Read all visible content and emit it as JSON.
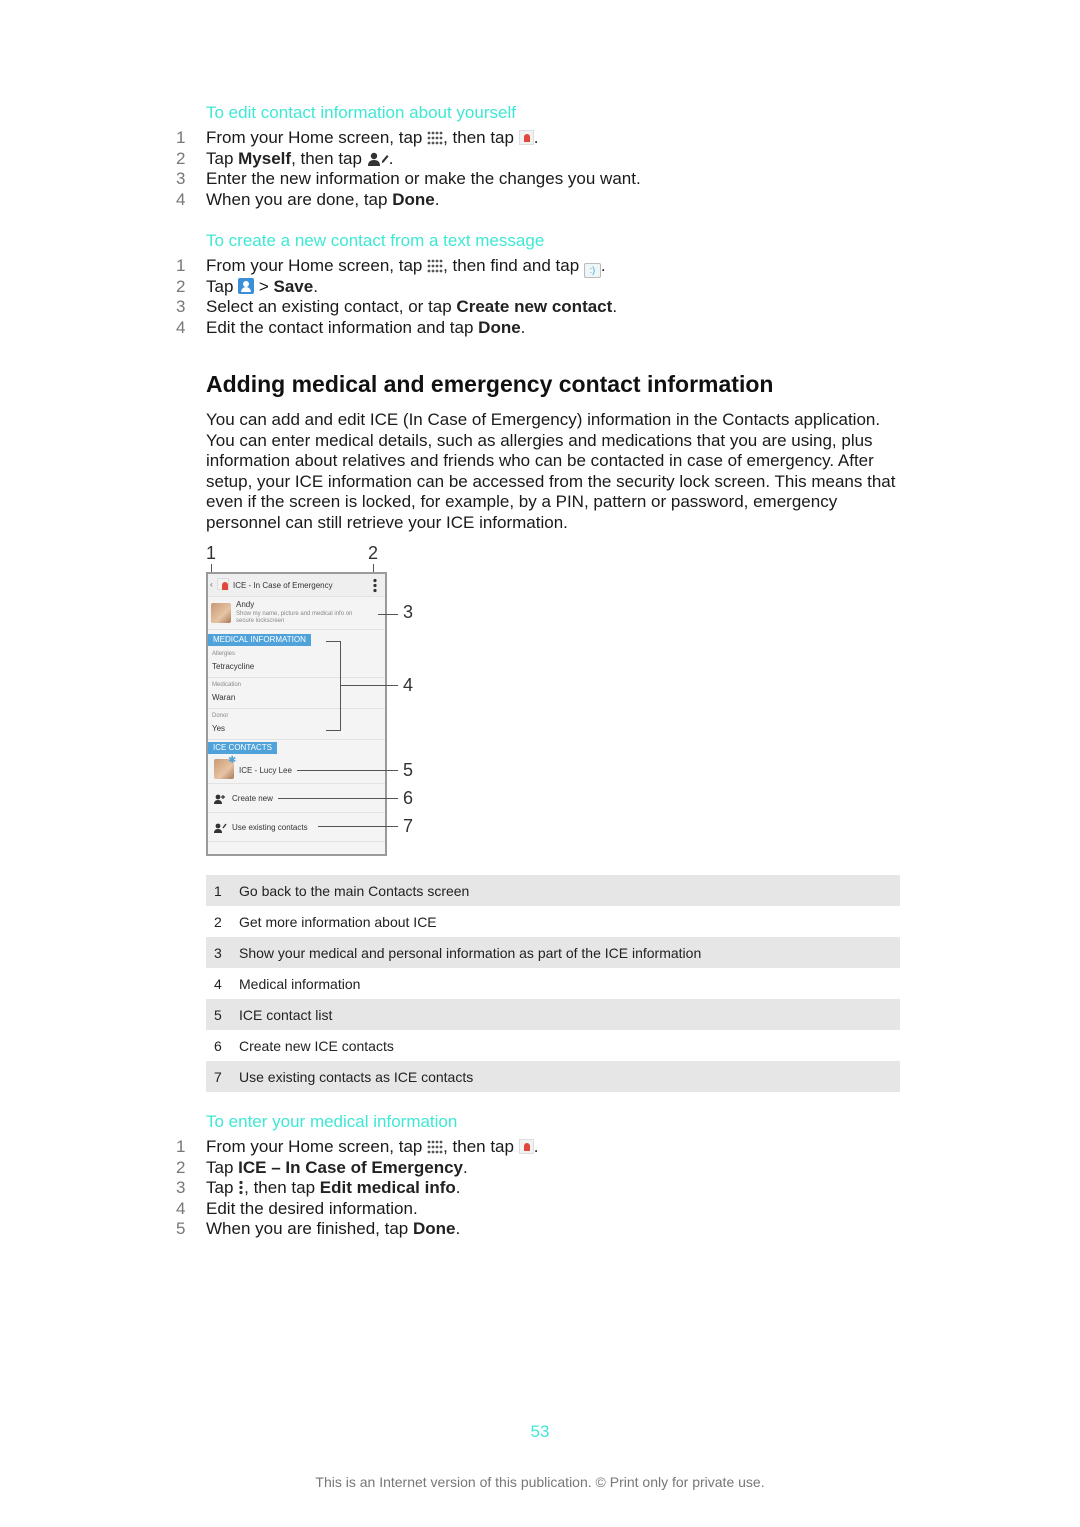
{
  "accent_color": "#3fe8d4",
  "section1": {
    "title": "To edit contact information about yourself",
    "steps": [
      {
        "num": "1",
        "a": "From your Home screen, tap ",
        "icon1": "apps-grid-icon",
        "b": ", then tap ",
        "icon2": "contacts-app-icon",
        "c": "."
      },
      {
        "num": "2",
        "a": "Tap ",
        "bold": "Myself",
        "b": ", then tap ",
        "icon": "edit-contact-icon",
        "c": "."
      },
      {
        "num": "3",
        "a": "Enter the new information or make the changes you want."
      },
      {
        "num": "4",
        "a": "When you are done, tap ",
        "bold": "Done",
        "c": "."
      }
    ]
  },
  "section2": {
    "title": "To create a new contact from a text message",
    "steps": [
      {
        "num": "1",
        "a": "From your Home screen, tap ",
        "icon1": "apps-grid-icon",
        "b": ", then find and tap ",
        "icon2": "messaging-app-icon",
        "c": "."
      },
      {
        "num": "2",
        "a": "Tap ",
        "icon": "add-contact-icon",
        "b": " > ",
        "bold": "Save",
        "c": "."
      },
      {
        "num": "3",
        "a": "Select an existing contact, or tap ",
        "bold": "Create new contact",
        "c": "."
      },
      {
        "num": "4",
        "a": "Edit the contact information and tap ",
        "bold": "Done",
        "c": "."
      }
    ]
  },
  "main_section": {
    "title": "Adding medical and emergency contact information",
    "intro": "You can add and edit ICE (In Case of Emergency) information in the Contacts application. You can enter medical details, such as allergies and medications that you are using, plus information about relatives and friends who can be contacted in case of emergency. After setup, your ICE information can be accessed from the security lock screen. This means that even if the screen is locked, for example, by a PIN, pattern or password, emergency personnel can still retrieve your ICE information."
  },
  "figure": {
    "callouts": [
      "1",
      "2",
      "3",
      "4",
      "5",
      "6",
      "7"
    ],
    "screen": {
      "title": "ICE - In Case of Emergency",
      "owner_name": "Andy",
      "owner_desc_line1": "Show my name, picture and medical info on",
      "owner_desc_line2": "secure lockscreen",
      "medical_header": "MEDICAL INFORMATION",
      "fields": [
        {
          "label": "Allergies",
          "value": "Tetracycline"
        },
        {
          "label": "Medication",
          "value": "Waran"
        },
        {
          "label": "Donor",
          "value": "Yes"
        }
      ],
      "contacts_header": "ICE CONTACTS",
      "ice_contact": "ICE - Lucy Lee",
      "create_new": "Create new",
      "use_existing": "Use existing contacts"
    }
  },
  "legend": [
    {
      "num": "1",
      "text": "Go back to the main Contacts screen"
    },
    {
      "num": "2",
      "text": "Get more information about ICE"
    },
    {
      "num": "3",
      "text": "Show your medical and personal information as part of the ICE information"
    },
    {
      "num": "4",
      "text": "Medical information"
    },
    {
      "num": "5",
      "text": "ICE contact list"
    },
    {
      "num": "6",
      "text": "Create new ICE contacts"
    },
    {
      "num": "7",
      "text": "Use existing contacts as ICE contacts"
    }
  ],
  "section3": {
    "title": "To enter your medical information",
    "steps": [
      {
        "num": "1",
        "a": "From your Home screen, tap ",
        "icon1": "apps-grid-icon",
        "b": ", then tap ",
        "icon2": "contacts-app-icon",
        "c": "."
      },
      {
        "num": "2",
        "a": "Tap ",
        "bold": "ICE – In Case of Emergency",
        "c": "."
      },
      {
        "num": "3",
        "a": "Tap ",
        "icon": "more-menu-icon",
        "b": ", then tap ",
        "bold": "Edit medical info",
        "c": "."
      },
      {
        "num": "4",
        "a": "Edit the desired information."
      },
      {
        "num": "5",
        "a": "When you are finished, tap ",
        "bold": "Done",
        "c": "."
      }
    ]
  },
  "page_number": "53",
  "footer": "This is an Internet version of this publication. © Print only for private use."
}
